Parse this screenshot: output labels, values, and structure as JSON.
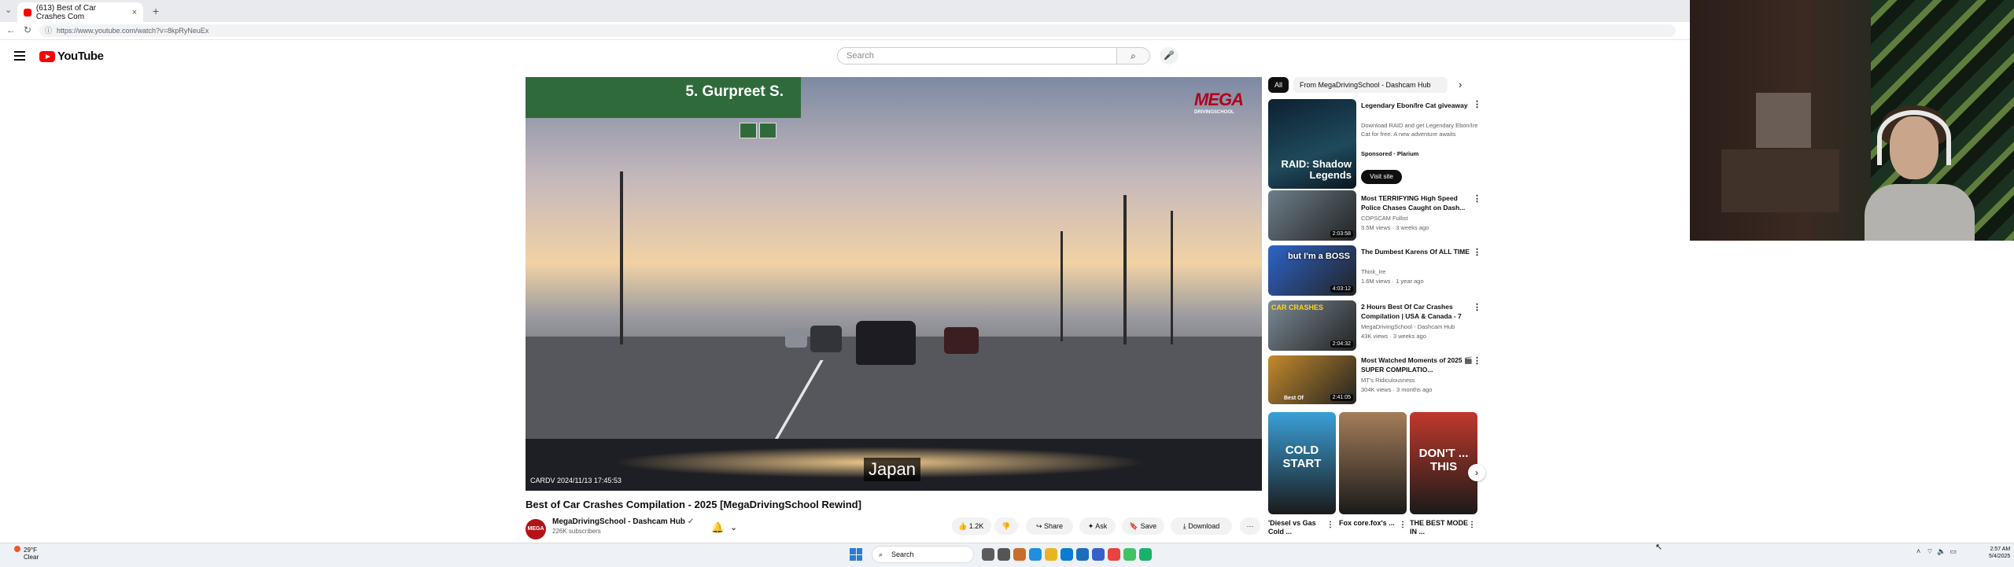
{
  "browser": {
    "tab_title": "(613) Best of Car Crashes Com",
    "tab_close": "×",
    "new_tab": "+",
    "url": "https://www.youtube.com/watch?v=8kpRyNeuEx",
    "back": "←",
    "reload": "↻"
  },
  "youtube": {
    "logo_text": "YouTube",
    "search_placeholder": "Search"
  },
  "video": {
    "sign_text": "5. Gurpreet S.",
    "brand": "MEGA",
    "brand_sub": "DRIVINGSCHOOL",
    "caption": "Japan",
    "dashcam_stamp": "CARDV  2024/11/13   17:45:53",
    "title": "Best of Car Crashes Compilation - 2025 [MegaDrivingSchool Rewind]"
  },
  "channel": {
    "avatar_text": "MEGA",
    "name": "MegaDrivingSchool - Dashcam Hub",
    "verified": "✓",
    "subscribers": "226K subscribers"
  },
  "actions": {
    "like_count": "1.2K",
    "share": "Share",
    "ask": "Ask",
    "save": "Save",
    "download": "Download",
    "more": "···"
  },
  "sidebar": {
    "chips": [
      "All",
      "From MegaDrivingSchool - Dashcam Hub"
    ],
    "sponsored": {
      "title": "Legendary Ebon/Ire Cat giveaway",
      "description": "Download RAID and get Legendary Ebon/Ire Cat for free. A new adventure awaits",
      "label": "Sponsored · Plarium",
      "cta": "Visit site",
      "thumb_text": "RAID: Shadow Legends"
    },
    "videos": [
      {
        "title": "Most TERRIFYING High Speed Police Chases Caught on Dash...",
        "channel": "COPSCAM Fullist",
        "meta": "3.5M views · 3 weeks ago",
        "duration": "2:03:58",
        "thumb_color": "#6d7f8a"
      },
      {
        "title": "The Dumbest Karens Of ALL TIME",
        "channel": "Think_Ire",
        "meta": "1.6M views · 1 year ago",
        "duration": "4:03:12",
        "thumb_color": "#2d64c8",
        "thumb_text": "but I'm a BOSS"
      },
      {
        "title": "2 Hours Best Of Car Crashes Compilation | USA & Canada - 7",
        "channel": "MegaDrivingSchool - Dashcam Hub",
        "meta": "43K views · 3 weeks ago",
        "duration": "2:04:32",
        "thumb_color": "#7b8a95",
        "thumb_text": "CAR CRASHES"
      },
      {
        "title": "Most Watched Moments of 2025 🎬 SUPER COMPILATIO...",
        "channel": "MT's Ridiculousness",
        "meta": "304K views · 3 months ago",
        "duration": "2:41:05",
        "thumb_color": "#c48a2b",
        "thumb_text": "Best Of"
      }
    ],
    "shorts": [
      {
        "label": "'Diesel vs Gas Cold ...",
        "thumb_text": "COLD START",
        "color": "#3aa0d8"
      },
      {
        "label": "Fox core.fox's ...",
        "thumb_text": "",
        "color": "#a57d5a"
      },
      {
        "label": "THE BEST MODE IN ...",
        "thumb_text": "DON'T ... THIS",
        "color": "#c0392b"
      }
    ]
  },
  "taskbar": {
    "weather_temp": "29°F",
    "weather_desc": "Clear",
    "search": "Search",
    "time": "2:57 AM",
    "date": "5/4/2025"
  }
}
